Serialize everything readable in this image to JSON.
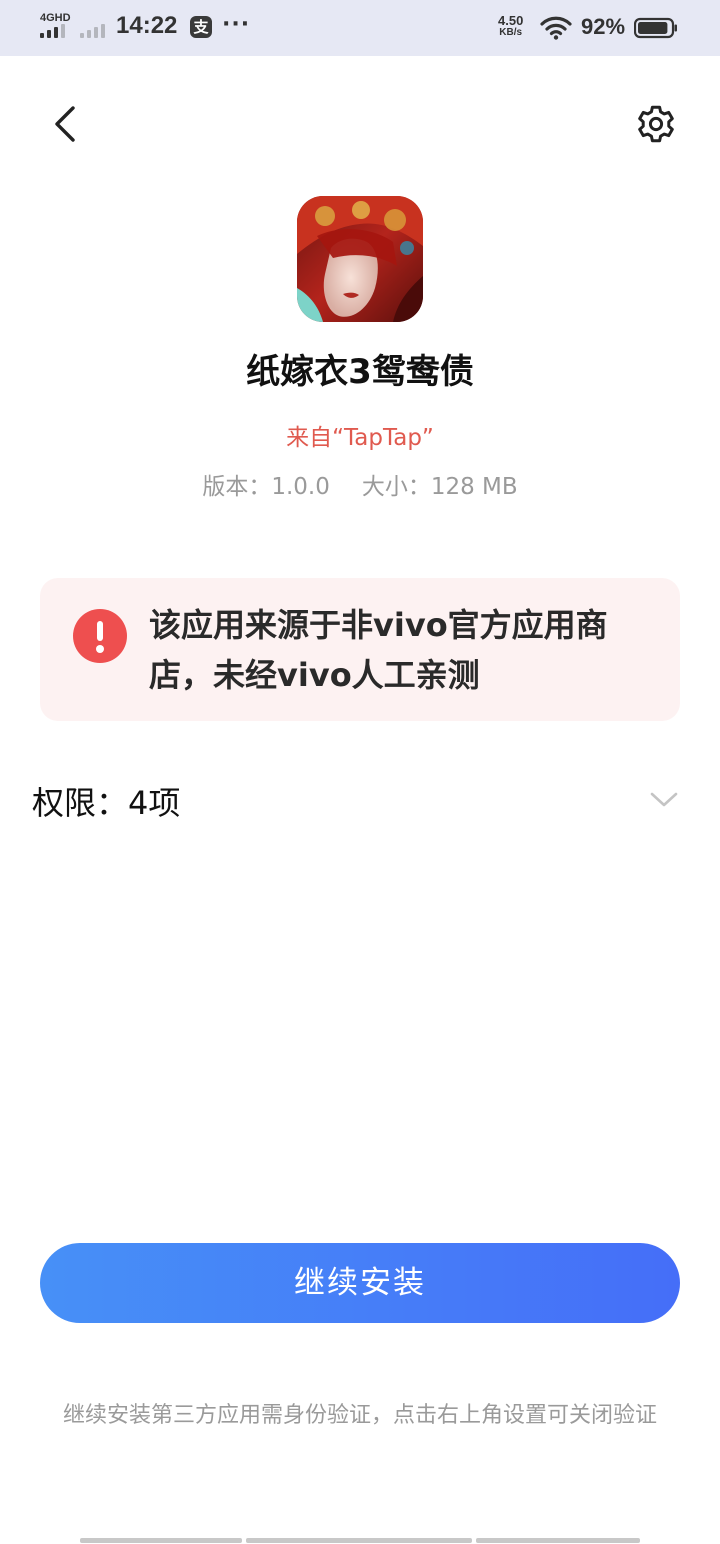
{
  "status_bar": {
    "network": "4GHD",
    "time": "14:22",
    "alipay_glyph": "支",
    "more": "···",
    "speed_value": "4.50",
    "speed_unit": "KB/s",
    "battery_percent": "92%",
    "battery_level": 0.92,
    "icons": [
      "signal-icon",
      "wifi-icon",
      "battery-icon",
      "alipay-icon"
    ]
  },
  "nav": {
    "back_icon": "chevron-left-icon",
    "settings_icon": "gear-icon"
  },
  "app": {
    "name": "纸嫁衣3鸳鸯债",
    "source": "来自“TapTap”",
    "version": "版本：1.0.0",
    "size": "大小：128 MB"
  },
  "warning": {
    "icon": "exclamation-circle-icon",
    "text": "该应用来源于非vivo官方应用商店，未经vivo人工亲测",
    "color": "#ee4f4f"
  },
  "permissions": {
    "label": "权限：4项",
    "chevron_icon": "chevron-down-icon"
  },
  "actions": {
    "continue_label": "继续安装",
    "accent": "#456ef8"
  },
  "footnote": "继续安装第三方应用需身份验证，点击右上角设置可关闭验证"
}
